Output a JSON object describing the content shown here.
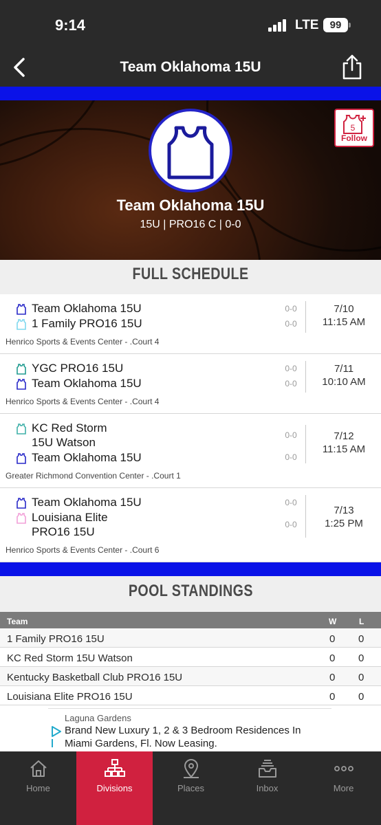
{
  "status_bar": {
    "time": "9:14",
    "network": "LTE",
    "battery": "99"
  },
  "nav": {
    "title": "Team Oklahoma 15U",
    "back_icon": "chevron-left-icon",
    "share_icon": "share-icon"
  },
  "hero": {
    "team_name": "Team Oklahoma 15U",
    "meta": "15U | PRO16 C | 0-0",
    "follow": {
      "count": "5",
      "label": "Follow"
    }
  },
  "colors": {
    "accent_red": "#d0213f",
    "stripe_blue": "#0a12e8",
    "dark_bg": "#2a2a2a"
  },
  "schedule": {
    "title": "FULL SCHEDULE",
    "games": [
      {
        "teams": [
          {
            "name": "Team Oklahoma 15U",
            "score": "0-0",
            "jersey_color": "#2828c8"
          },
          {
            "name": "1 Family PRO16 15U",
            "score": "0-0",
            "jersey_color": "#7fd8ee"
          }
        ],
        "date": "7/10",
        "time": "11:15 AM",
        "venue": "Henrico Sports & Events Center - .Court 4"
      },
      {
        "teams": [
          {
            "name": "YGC PRO16 15U",
            "score": "0-0",
            "jersey_color": "#1f9b8f"
          },
          {
            "name": "Team Oklahoma 15U",
            "score": "0-0",
            "jersey_color": "#2828c8"
          }
        ],
        "date": "7/11",
        "time": "10:10 AM",
        "venue": "Henrico Sports & Events Center - .Court 4"
      },
      {
        "teams": [
          {
            "name_line1": "KC Red Storm",
            "name_line2": "15U Watson",
            "score": "0-0",
            "jersey_color": "#3fb0a8"
          },
          {
            "name": "Team Oklahoma 15U",
            "score": "0-0",
            "jersey_color": "#2828c8"
          }
        ],
        "date": "7/12",
        "time": "11:15 AM",
        "venue": "Greater Richmond Convention Center - .Court 1"
      },
      {
        "teams": [
          {
            "name": "Team Oklahoma 15U",
            "score": "0-0",
            "jersey_color": "#2828c8"
          },
          {
            "name_line1": "Louisiana Elite",
            "name_line2": "PRO16 15U",
            "score": "0-0",
            "jersey_color": "#f2a0d8"
          }
        ],
        "date": "7/13",
        "time": "1:25 PM",
        "venue": "Henrico Sports & Events Center - .Court 6"
      }
    ]
  },
  "standings": {
    "title": "POOL STANDINGS",
    "columns": [
      "Team",
      "W",
      "L"
    ],
    "rows": [
      {
        "team": "1 Family PRO16 15U",
        "w": "0",
        "l": "0"
      },
      {
        "team": "KC Red Storm 15U Watson",
        "w": "0",
        "l": "0"
      },
      {
        "team": "Kentucky Basketball Club PRO16 15U",
        "w": "0",
        "l": "0"
      },
      {
        "team": "Louisiana Elite PRO16 15U",
        "w": "0",
        "l": "0"
      }
    ]
  },
  "ad": {
    "advertiser": "Laguna Gardens",
    "line1": "Brand New Luxury 1, 2 & 3 Bedroom Residences In",
    "line2": "Miami Gardens, Fl. Now Leasing."
  },
  "tabs": [
    {
      "label": "Home",
      "icon": "home-icon",
      "active": false
    },
    {
      "label": "Divisions",
      "icon": "divisions-icon",
      "active": true
    },
    {
      "label": "Places",
      "icon": "places-icon",
      "active": false
    },
    {
      "label": "Inbox",
      "icon": "inbox-icon",
      "active": false
    },
    {
      "label": "More",
      "icon": "more-icon",
      "active": false
    }
  ]
}
